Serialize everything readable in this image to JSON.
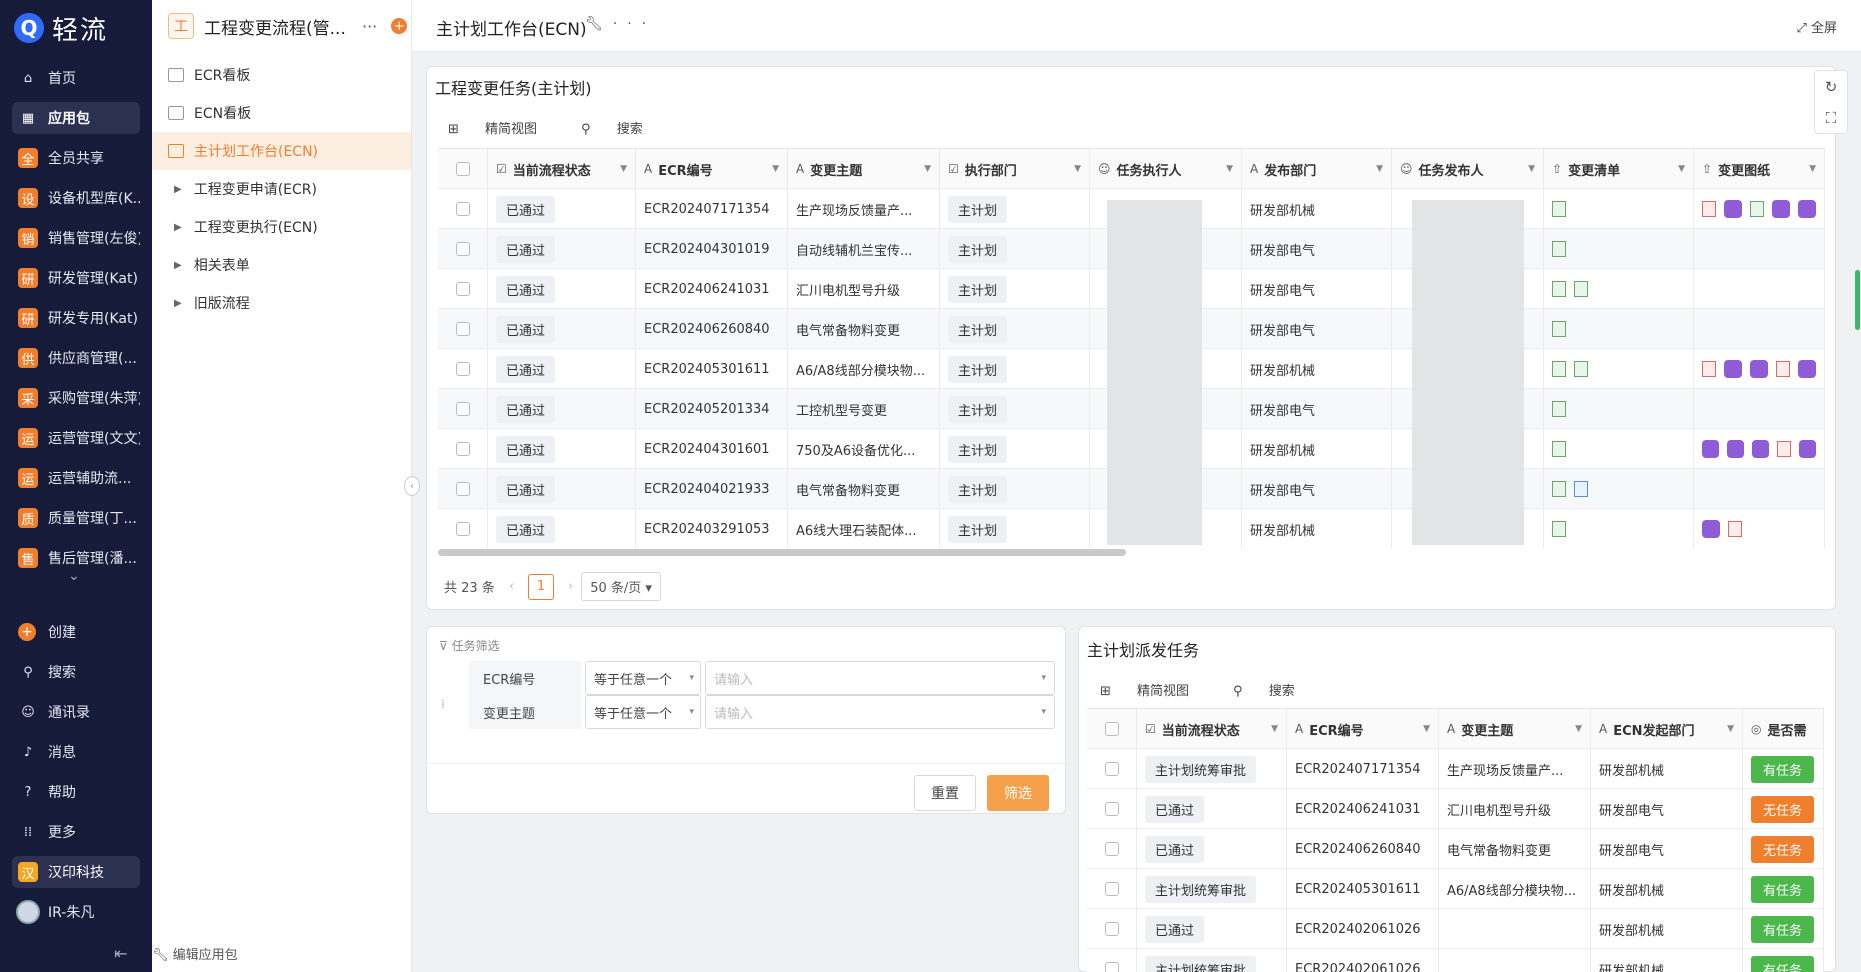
{
  "brand": {
    "logo_letter": "Q",
    "name": "轻流"
  },
  "nav": {
    "items": [
      {
        "label": "首页",
        "icon": "home-icon"
      },
      {
        "label": "应用包",
        "icon": "apps-icon",
        "active": true
      },
      {
        "label": "全员共享",
        "badge": "全"
      },
      {
        "label": "设备机型库(K...",
        "badge": "设"
      },
      {
        "label": "销售管理(左俊)",
        "badge": "销"
      },
      {
        "label": "研发管理(Kat)",
        "badge": "研"
      },
      {
        "label": "研发专用(Kat)",
        "badge": "研"
      },
      {
        "label": "供应商管理(...",
        "badge": "供"
      },
      {
        "label": "采购管理(朱萍)",
        "badge": "采"
      },
      {
        "label": "运营管理(文文)",
        "badge": "运"
      },
      {
        "label": "运营辅助流...",
        "badge": "运"
      },
      {
        "label": "质量管理(丁...",
        "badge": "质"
      },
      {
        "label": "售后管理(潘...",
        "badge": "售"
      }
    ],
    "bottom": [
      {
        "label": "创建",
        "icon": "plus-icon"
      },
      {
        "label": "搜索",
        "icon": "search-icon"
      },
      {
        "label": "通讯录",
        "icon": "contacts-icon"
      },
      {
        "label": "消息",
        "icon": "bell-icon"
      },
      {
        "label": "帮助",
        "icon": "help-icon"
      },
      {
        "label": "更多",
        "icon": "grid-icon"
      }
    ],
    "company": {
      "badge": "汉",
      "label": "汉印科技"
    },
    "user": "IR-朱凡"
  },
  "sub": {
    "icon": "工",
    "title": "工程变更流程(管...",
    "items": [
      {
        "label": "ECR看板",
        "type": "board"
      },
      {
        "label": "ECN看板",
        "type": "board"
      },
      {
        "label": "主计划工作台(ECN)",
        "type": "board",
        "active": true
      },
      {
        "label": "工程变更申请(ECR)",
        "type": "folder"
      },
      {
        "label": "工程变更执行(ECN)",
        "type": "folder"
      },
      {
        "label": "相关表单",
        "type": "folder"
      },
      {
        "label": "旧版流程",
        "type": "folder"
      }
    ],
    "footer": "编辑应用包"
  },
  "topbar": {
    "title": "主计划工作台(ECN)",
    "fullscreen": "全屏"
  },
  "task_table": {
    "title": "工程变更任务(主计划)",
    "toolbar": {
      "view": "精简视图",
      "search": "搜索"
    },
    "headers": [
      "当前流程状态",
      "ECR编号",
      "变更主题",
      "执行部门",
      "任务执行人",
      "发布部门",
      "任务发布人",
      "变更清单",
      "变更图纸"
    ],
    "rows": [
      {
        "status": "已通过",
        "ecr": "ECR202407171354",
        "topic": "生产现场反馈量产...",
        "dept": "主计划",
        "pub": "研发部机械",
        "list": [
          "xlsx"
        ],
        "draw": [
          "pdf",
          "purple",
          "else",
          "purple",
          "purple"
        ]
      },
      {
        "status": "已通过",
        "ecr": "ECR202404301019",
        "topic": "自动线辅机兰宝传...",
        "dept": "主计划",
        "pub": "研发部电气",
        "list": [
          "xlsx"
        ],
        "draw": []
      },
      {
        "status": "已通过",
        "ecr": "ECR202406241031",
        "topic": "汇川电机型号升级",
        "dept": "主计划",
        "pub": "研发部电气",
        "list": [
          "xlsx",
          "xlsx"
        ],
        "draw": []
      },
      {
        "status": "已通过",
        "ecr": "ECR202406260840",
        "topic": "电气常备物料变更",
        "dept": "主计划",
        "pub": "研发部电气",
        "list": [
          "xlsx"
        ],
        "draw": []
      },
      {
        "status": "已通过",
        "ecr": "ECR202405301611",
        "topic": "A6/A8线部分模块物...",
        "dept": "主计划",
        "pub": "研发部机械",
        "list": [
          "xlsx",
          "xlsx"
        ],
        "draw": [
          "pdf",
          "purple",
          "purple",
          "pdf",
          "purple"
        ]
      },
      {
        "status": "已通过",
        "ecr": "ECR202405201334",
        "topic": "工控机型号变更",
        "dept": "主计划",
        "pub": "研发部电气",
        "list": [
          "xlsx"
        ],
        "draw": []
      },
      {
        "status": "已通过",
        "ecr": "ECR202404301601",
        "topic": "750及A6设备优化...",
        "dept": "主计划",
        "pub": "研发部机械",
        "list": [
          "xlsx"
        ],
        "draw": [
          "purple",
          "purple",
          "purple",
          "pdf",
          "purple"
        ]
      },
      {
        "status": "已通过",
        "ecr": "ECR202404021933",
        "topic": "电气常备物料变更",
        "dept": "主计划",
        "pub": "研发部电气",
        "list": [
          "xlsx",
          "docx"
        ],
        "draw": []
      },
      {
        "status": "已通过",
        "ecr": "ECR202403291053",
        "topic": "A6线大理石装配体...",
        "dept": "主计划",
        "pub": "研发部机械",
        "list": [
          "xlsx"
        ],
        "draw": [
          "purple",
          "pdf"
        ]
      }
    ],
    "pager": {
      "total": "共 23 条",
      "page": "1",
      "size": "50 条/页"
    }
  },
  "filter": {
    "title": "任务筛选",
    "rows": [
      {
        "label": "ECR编号",
        "op": "等于任意一个",
        "placeholder": "请输入"
      },
      {
        "label": "变更主题",
        "op": "等于任意一个",
        "placeholder": "请输入"
      }
    ],
    "reset": "重置",
    "submit": "筛选"
  },
  "dispatch_table": {
    "title": "主计划派发任务",
    "toolbar": {
      "view": "精简视图",
      "search": "搜索"
    },
    "headers": [
      "当前流程状态",
      "ECR编号",
      "变更主题",
      "ECN发起部门",
      "是否需"
    ],
    "rows": [
      {
        "status": "主计划统筹审批",
        "ecr": "ECR202407171354",
        "topic": "生产现场反馈量产...",
        "dept": "研发部机械",
        "task": "有任务",
        "color": "#4cb84c"
      },
      {
        "status": "已通过",
        "ecr": "ECR202406241031",
        "topic": "汇川电机型号升级",
        "dept": "研发部电气",
        "task": "无任务",
        "color": "#f07f2d"
      },
      {
        "status": "已通过",
        "ecr": "ECR202406260840",
        "topic": "电气常备物料变更",
        "dept": "研发部电气",
        "task": "无任务",
        "color": "#f07f2d"
      },
      {
        "status": "主计划统筹审批",
        "ecr": "ECR202405301611",
        "topic": "A6/A8线部分模块物...",
        "dept": "研发部机械",
        "task": "有任务",
        "color": "#4cb84c"
      },
      {
        "status": "已通过",
        "ecr": "ECR202402061026",
        "topic": "",
        "dept": "研发部机械",
        "task": "有任务",
        "color": "#4cb84c"
      },
      {
        "status": "主计划统筹审批",
        "ecr": "ECR202402061026",
        "topic": "",
        "dept": "研发部机械",
        "task": "有任务",
        "color": "#4cb84c"
      }
    ]
  },
  "colors": {
    "accent": "#f07f2d",
    "nav_bg": "#161b3a",
    "green": "#4cb84c"
  }
}
